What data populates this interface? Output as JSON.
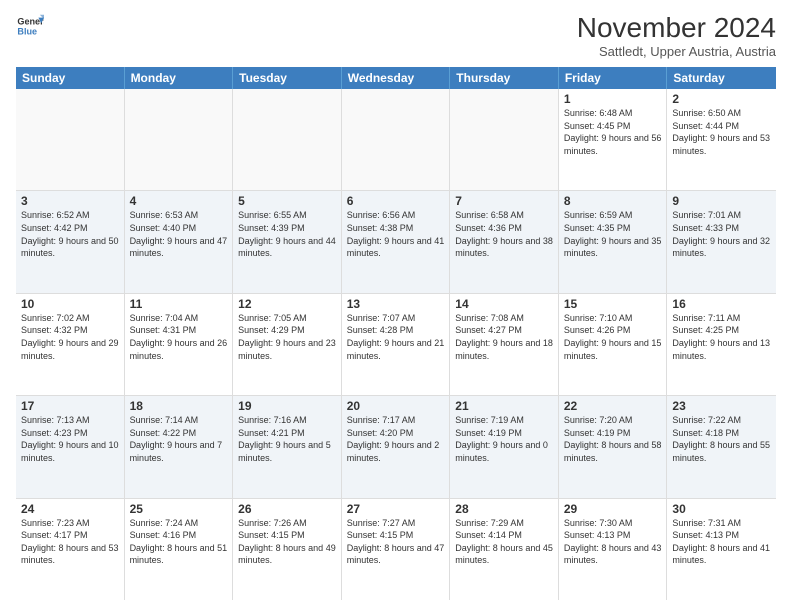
{
  "logo": {
    "line1": "General",
    "line2": "Blue"
  },
  "title": "November 2024",
  "location": "Sattledt, Upper Austria, Austria",
  "days_of_week": [
    "Sunday",
    "Monday",
    "Tuesday",
    "Wednesday",
    "Thursday",
    "Friday",
    "Saturday"
  ],
  "weeks": [
    [
      {
        "day": "",
        "empty": true
      },
      {
        "day": "",
        "empty": true
      },
      {
        "day": "",
        "empty": true
      },
      {
        "day": "",
        "empty": true
      },
      {
        "day": "",
        "empty": true
      },
      {
        "day": "1",
        "sunrise": "6:48 AM",
        "sunset": "4:45 PM",
        "daylight": "9 hours and 56 minutes."
      },
      {
        "day": "2",
        "sunrise": "6:50 AM",
        "sunset": "4:44 PM",
        "daylight": "9 hours and 53 minutes."
      }
    ],
    [
      {
        "day": "3",
        "sunrise": "6:52 AM",
        "sunset": "4:42 PM",
        "daylight": "9 hours and 50 minutes."
      },
      {
        "day": "4",
        "sunrise": "6:53 AM",
        "sunset": "4:40 PM",
        "daylight": "9 hours and 47 minutes."
      },
      {
        "day": "5",
        "sunrise": "6:55 AM",
        "sunset": "4:39 PM",
        "daylight": "9 hours and 44 minutes."
      },
      {
        "day": "6",
        "sunrise": "6:56 AM",
        "sunset": "4:38 PM",
        "daylight": "9 hours and 41 minutes."
      },
      {
        "day": "7",
        "sunrise": "6:58 AM",
        "sunset": "4:36 PM",
        "daylight": "9 hours and 38 minutes."
      },
      {
        "day": "8",
        "sunrise": "6:59 AM",
        "sunset": "4:35 PM",
        "daylight": "9 hours and 35 minutes."
      },
      {
        "day": "9",
        "sunrise": "7:01 AM",
        "sunset": "4:33 PM",
        "daylight": "9 hours and 32 minutes."
      }
    ],
    [
      {
        "day": "10",
        "sunrise": "7:02 AM",
        "sunset": "4:32 PM",
        "daylight": "9 hours and 29 minutes."
      },
      {
        "day": "11",
        "sunrise": "7:04 AM",
        "sunset": "4:31 PM",
        "daylight": "9 hours and 26 minutes."
      },
      {
        "day": "12",
        "sunrise": "7:05 AM",
        "sunset": "4:29 PM",
        "daylight": "9 hours and 23 minutes."
      },
      {
        "day": "13",
        "sunrise": "7:07 AM",
        "sunset": "4:28 PM",
        "daylight": "9 hours and 21 minutes."
      },
      {
        "day": "14",
        "sunrise": "7:08 AM",
        "sunset": "4:27 PM",
        "daylight": "9 hours and 18 minutes."
      },
      {
        "day": "15",
        "sunrise": "7:10 AM",
        "sunset": "4:26 PM",
        "daylight": "9 hours and 15 minutes."
      },
      {
        "day": "16",
        "sunrise": "7:11 AM",
        "sunset": "4:25 PM",
        "daylight": "9 hours and 13 minutes."
      }
    ],
    [
      {
        "day": "17",
        "sunrise": "7:13 AM",
        "sunset": "4:23 PM",
        "daylight": "9 hours and 10 minutes."
      },
      {
        "day": "18",
        "sunrise": "7:14 AM",
        "sunset": "4:22 PM",
        "daylight": "9 hours and 7 minutes."
      },
      {
        "day": "19",
        "sunrise": "7:16 AM",
        "sunset": "4:21 PM",
        "daylight": "9 hours and 5 minutes."
      },
      {
        "day": "20",
        "sunrise": "7:17 AM",
        "sunset": "4:20 PM",
        "daylight": "9 hours and 2 minutes."
      },
      {
        "day": "21",
        "sunrise": "7:19 AM",
        "sunset": "4:19 PM",
        "daylight": "9 hours and 0 minutes."
      },
      {
        "day": "22",
        "sunrise": "7:20 AM",
        "sunset": "4:19 PM",
        "daylight": "8 hours and 58 minutes."
      },
      {
        "day": "23",
        "sunrise": "7:22 AM",
        "sunset": "4:18 PM",
        "daylight": "8 hours and 55 minutes."
      }
    ],
    [
      {
        "day": "24",
        "sunrise": "7:23 AM",
        "sunset": "4:17 PM",
        "daylight": "8 hours and 53 minutes."
      },
      {
        "day": "25",
        "sunrise": "7:24 AM",
        "sunset": "4:16 PM",
        "daylight": "8 hours and 51 minutes."
      },
      {
        "day": "26",
        "sunrise": "7:26 AM",
        "sunset": "4:15 PM",
        "daylight": "8 hours and 49 minutes."
      },
      {
        "day": "27",
        "sunrise": "7:27 AM",
        "sunset": "4:15 PM",
        "daylight": "8 hours and 47 minutes."
      },
      {
        "day": "28",
        "sunrise": "7:29 AM",
        "sunset": "4:14 PM",
        "daylight": "8 hours and 45 minutes."
      },
      {
        "day": "29",
        "sunrise": "7:30 AM",
        "sunset": "4:13 PM",
        "daylight": "8 hours and 43 minutes."
      },
      {
        "day": "30",
        "sunrise": "7:31 AM",
        "sunset": "4:13 PM",
        "daylight": "8 hours and 41 minutes."
      }
    ]
  ]
}
